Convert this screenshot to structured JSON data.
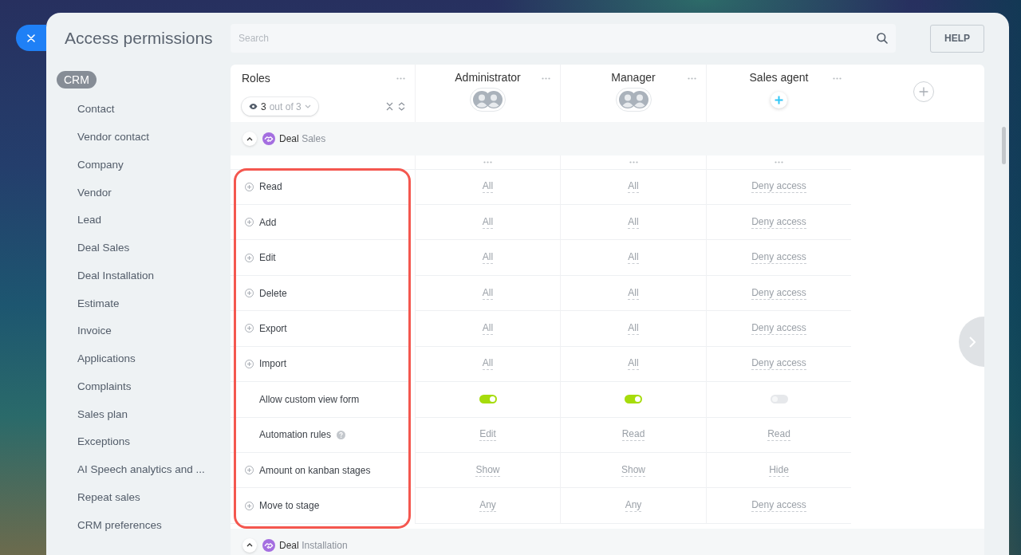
{
  "window": {
    "title": "Access permissions"
  },
  "search": {
    "placeholder": "Search"
  },
  "help_button": {
    "label": "HELP"
  },
  "sidebar": {
    "group": "CRM",
    "items": [
      "Contact",
      "Vendor contact",
      "Company",
      "Vendor",
      "Lead",
      "Deal Sales",
      "Deal Installation",
      "Estimate",
      "Invoice",
      "Applications",
      "Complaints",
      "Sales plan",
      "Exceptions",
      "AI Speech analytics and ...",
      "Repeat sales",
      "CRM preferences"
    ]
  },
  "table": {
    "roles_header": {
      "title": "Roles",
      "visible_count": "3",
      "visible_total": "out of 3"
    },
    "columns": [
      {
        "name": "Administrator",
        "members": [
          {
            "kind": "photo"
          },
          {
            "kind": "photo"
          }
        ]
      },
      {
        "name": "Manager",
        "members": [
          {
            "kind": "photo"
          },
          {
            "kind": "photo"
          }
        ]
      },
      {
        "name": "Sales agent"
      }
    ],
    "sections": [
      {
        "entity": "Deal",
        "category": "Sales",
        "expanded": true,
        "highlighted": true,
        "rows": [
          {
            "label": "Read",
            "expandable": true,
            "help": false,
            "cells": [
              {
                "kind": "text",
                "text": "All"
              },
              {
                "kind": "text",
                "text": "All"
              },
              {
                "kind": "text",
                "text": "Deny access"
              }
            ]
          },
          {
            "label": "Add",
            "expandable": true,
            "help": false,
            "cells": [
              {
                "kind": "text",
                "text": "All"
              },
              {
                "kind": "text",
                "text": "All"
              },
              {
                "kind": "text",
                "text": "Deny access"
              }
            ]
          },
          {
            "label": "Edit",
            "expandable": true,
            "help": false,
            "cells": [
              {
                "kind": "text",
                "text": "All"
              },
              {
                "kind": "text",
                "text": "All"
              },
              {
                "kind": "text",
                "text": "Deny access"
              }
            ]
          },
          {
            "label": "Delete",
            "expandable": true,
            "help": false,
            "cells": [
              {
                "kind": "text",
                "text": "All"
              },
              {
                "kind": "text",
                "text": "All"
              },
              {
                "kind": "text",
                "text": "Deny access"
              }
            ]
          },
          {
            "label": "Export",
            "expandable": true,
            "help": false,
            "cells": [
              {
                "kind": "text",
                "text": "All"
              },
              {
                "kind": "text",
                "text": "All"
              },
              {
                "kind": "text",
                "text": "Deny access"
              }
            ]
          },
          {
            "label": "Import",
            "expandable": true,
            "help": false,
            "cells": [
              {
                "kind": "text",
                "text": "All"
              },
              {
                "kind": "text",
                "text": "All"
              },
              {
                "kind": "text",
                "text": "Deny access"
              }
            ]
          },
          {
            "label": "Allow custom view form",
            "expandable": false,
            "help": false,
            "cells": [
              {
                "kind": "toggle",
                "on": true
              },
              {
                "kind": "toggle",
                "on": true
              },
              {
                "kind": "toggle",
                "on": false
              }
            ]
          },
          {
            "label": "Automation rules",
            "expandable": false,
            "help": true,
            "cells": [
              {
                "kind": "text",
                "text": "Edit"
              },
              {
                "kind": "text",
                "text": "Read"
              },
              {
                "kind": "text",
                "text": "Read"
              }
            ]
          },
          {
            "label": "Amount on kanban stages",
            "expandable": true,
            "help": false,
            "cells": [
              {
                "kind": "text",
                "text": "Show"
              },
              {
                "kind": "text",
                "text": "Show"
              },
              {
                "kind": "text",
                "text": "Hide"
              }
            ]
          },
          {
            "label": "Move to stage",
            "expandable": true,
            "help": false,
            "cells": [
              {
                "kind": "text",
                "text": "Any"
              },
              {
                "kind": "text",
                "text": "Any"
              },
              {
                "kind": "text",
                "text": "Deny access"
              }
            ]
          }
        ]
      },
      {
        "entity": "Deal",
        "category": "Installation",
        "expanded": true,
        "highlighted": false
      }
    ]
  }
}
